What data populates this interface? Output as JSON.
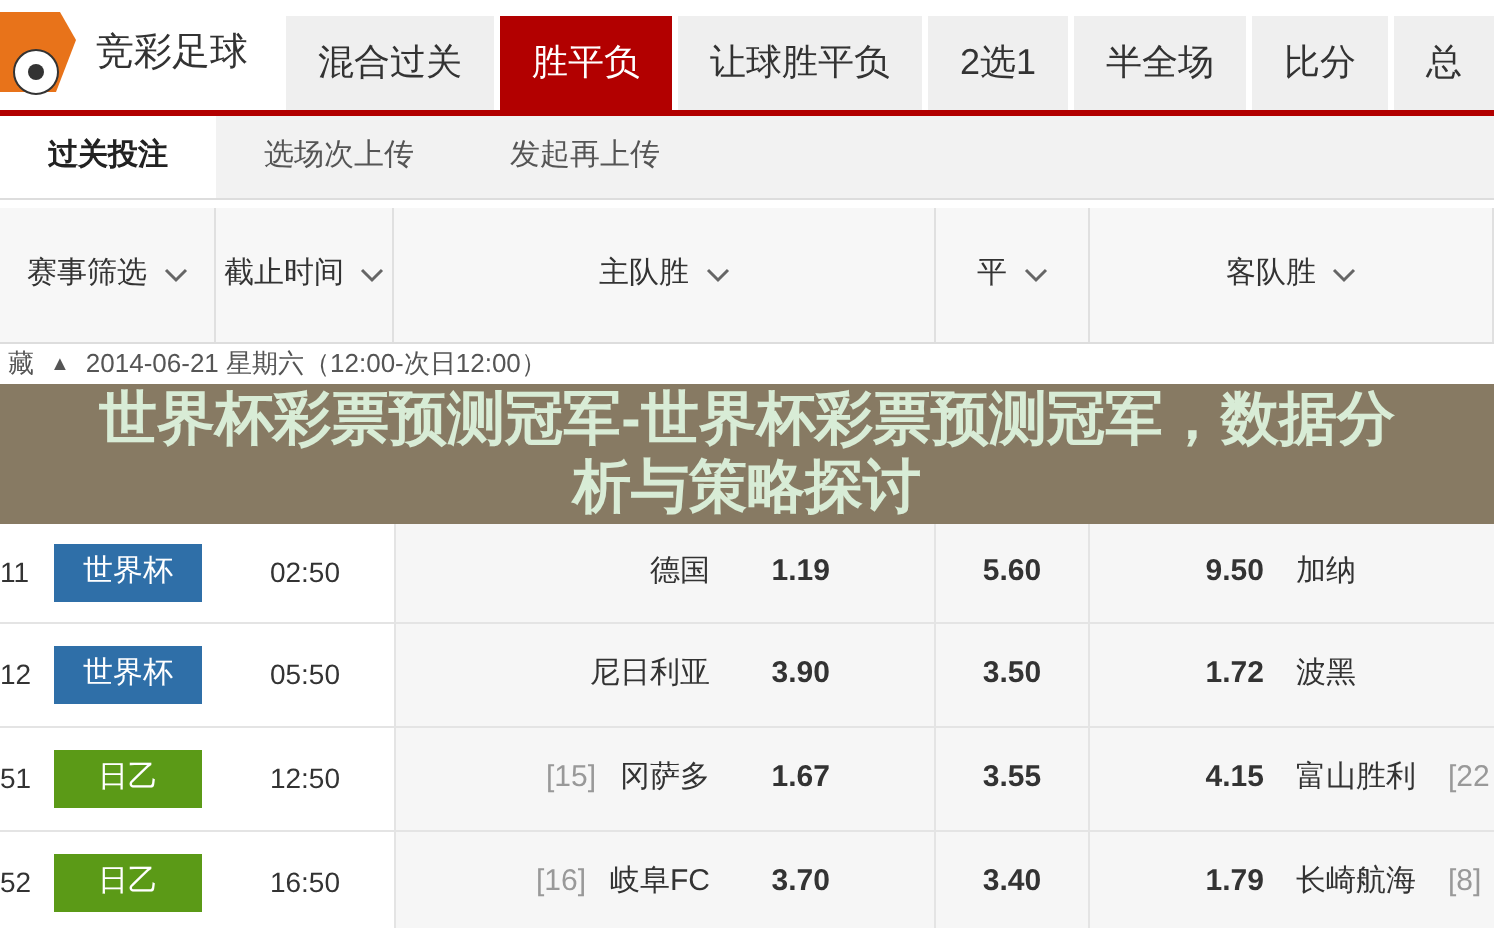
{
  "logo": {
    "title": "竞彩足球"
  },
  "tabs": [
    {
      "label": "混合过关",
      "selected": false
    },
    {
      "label": "胜平负",
      "selected": true
    },
    {
      "label": "让球胜平负",
      "selected": false
    },
    {
      "label": "2选1",
      "selected": false
    },
    {
      "label": "半全场",
      "selected": false
    },
    {
      "label": "比分",
      "selected": false
    },
    {
      "label": "总",
      "selected": false
    }
  ],
  "subtabs": [
    {
      "label": "过关投注",
      "selected": true
    },
    {
      "label": "选场次上传",
      "selected": false
    },
    {
      "label": "发起再上传",
      "selected": false
    }
  ],
  "table": {
    "columns": [
      "赛事筛选",
      "截止时间",
      "主队胜",
      "平",
      "客队胜"
    ],
    "date_row": {
      "toggle": "藏",
      "arrow": "▲",
      "date": "2014-06-21 星期六（12:00-次日12:00）"
    },
    "rows": [
      {
        "number": "11",
        "league": "世界杯",
        "color": "#2f6fa8",
        "time": "02:50",
        "home_rank": "",
        "home": "德国",
        "home_odds": "1.19",
        "draw_odds": "5.60",
        "away_odds": "9.50",
        "away": "加纳",
        "away_rank": ""
      },
      {
        "number": "12",
        "league": "世界杯",
        "color": "#2f6fa8",
        "time": "05:50",
        "home_rank": "",
        "home": "尼日利亚",
        "home_odds": "3.90",
        "draw_odds": "3.50",
        "away_odds": "1.72",
        "away": "波黑",
        "away_rank": ""
      },
      {
        "number": "51",
        "league": "日乙",
        "color": "#5b9a17",
        "time": "12:50",
        "home_rank": "[15]",
        "home": "冈萨多",
        "home_odds": "1.67",
        "draw_odds": "3.55",
        "away_odds": "4.15",
        "away": "富山胜利",
        "away_rank": "[22"
      },
      {
        "number": "52",
        "league": "日乙",
        "color": "#5b9a17",
        "time": "16:50",
        "home_rank": "[16]",
        "home": "岐阜FC",
        "home_odds": "3.70",
        "draw_odds": "3.40",
        "away_odds": "1.79",
        "away": "长崎航海",
        "away_rank": "[8]"
      }
    ]
  },
  "banner": {
    "title": "世界杯彩票预测冠军-世界杯彩票预测冠军，数据分析与策略探讨"
  }
}
